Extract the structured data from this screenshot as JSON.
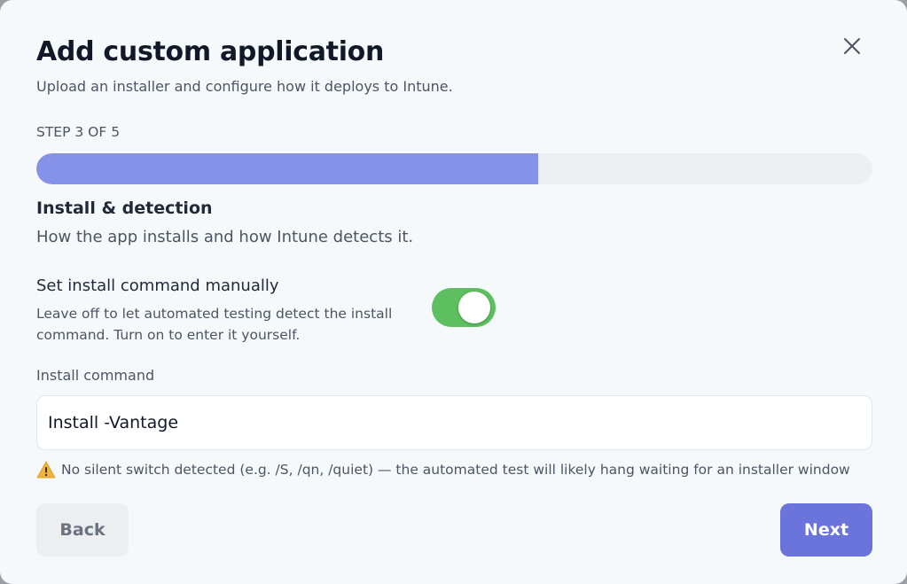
{
  "dialog": {
    "title": "Add custom application",
    "subtitle": "Upload an installer and configure how it deploys to Intune."
  },
  "progress": {
    "step_label": "STEP 3 OF 5",
    "fraction": 0.6,
    "fill_color": "#8592e8"
  },
  "section": {
    "title": "Install & detection",
    "description": "How the app installs and how Intune detects it."
  },
  "manual_command": {
    "label": "Set install command manually",
    "description": "Leave off to let automated testing detect the install command. Turn on to enter it yourself.",
    "enabled": true,
    "on_color": "#5dbf5f"
  },
  "install_command": {
    "label": "Install command",
    "value": "Install -Vantage"
  },
  "warning": {
    "icon": "warning-triangle-icon",
    "text": "No silent switch detected (e.g. /S, /qn, /quiet) — the automated test will likely hang waiting for an installer window"
  },
  "footer": {
    "back_label": "Back",
    "next_label": "Next",
    "next_color": "#6b74da"
  },
  "icons": {
    "close": "close-icon"
  }
}
